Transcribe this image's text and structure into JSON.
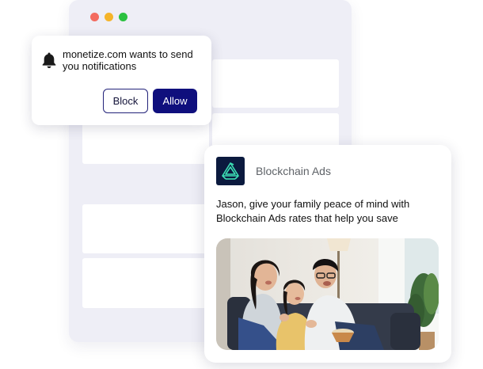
{
  "permission_prompt": {
    "message": "monetize.com wants to send you notifications",
    "block_label": "Block",
    "allow_label": "Allow",
    "icon": "bell-icon"
  },
  "ad_notification": {
    "brand_name": "Blockchain Ads",
    "brand_icon": "blockchain-ads-logo",
    "message": "Jason, give your family peace of mind with Blockchain Ads rates that help you save"
  },
  "colors": {
    "allow_button": "#0f0f7d",
    "block_border": "#23237a",
    "browser_bg": "#eeeef6",
    "logo_bg": "#0b1a3e",
    "logo_accent": "#3de0b5"
  }
}
